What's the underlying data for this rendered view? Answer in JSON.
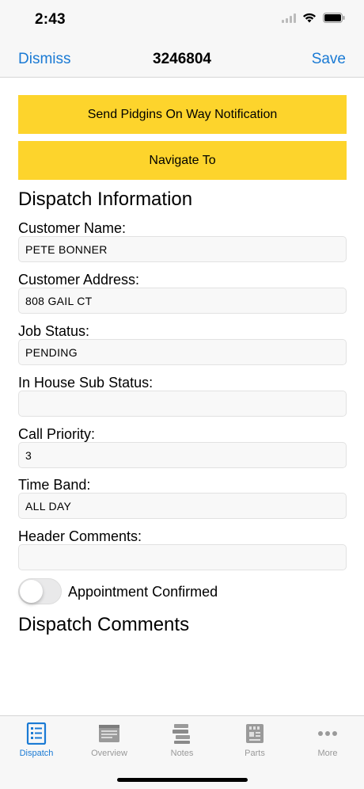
{
  "status": {
    "time": "2:43"
  },
  "nav": {
    "dismiss_label": "Dismiss",
    "title": "3246804",
    "save_label": "Save"
  },
  "actions": {
    "notify_label": "Send Pidgins On Way Notification",
    "navigate_label": "Navigate To"
  },
  "dispatch_info": {
    "title": "Dispatch Information",
    "fields": [
      {
        "label": "Customer Name:",
        "value": "PETE BONNER"
      },
      {
        "label": "Customer Address:",
        "value": "808 GAIL CT"
      },
      {
        "label": "Job Status:",
        "value": "PENDING"
      },
      {
        "label": "In House Sub Status:",
        "value": ""
      },
      {
        "label": "Call Priority:",
        "value": "3"
      },
      {
        "label": "Time Band:",
        "value": "ALL DAY"
      },
      {
        "label": "Header Comments:",
        "value": ""
      }
    ],
    "appointment_confirmed": {
      "label": "Appointment Confirmed",
      "on": false
    }
  },
  "dispatch_comments": {
    "title": "Dispatch Comments"
  },
  "tabs": [
    {
      "label": "Dispatch",
      "icon": "dispatch-icon",
      "active": true
    },
    {
      "label": "Overview",
      "icon": "overview-icon",
      "active": false
    },
    {
      "label": "Notes",
      "icon": "notes-icon",
      "active": false
    },
    {
      "label": "Parts",
      "icon": "parts-icon",
      "active": false
    },
    {
      "label": "More",
      "icon": "more-icon",
      "active": false
    }
  ],
  "colors": {
    "accent": "#1a7ad4",
    "button_yellow": "#fdd42c",
    "inactive_tab": "#999999"
  }
}
